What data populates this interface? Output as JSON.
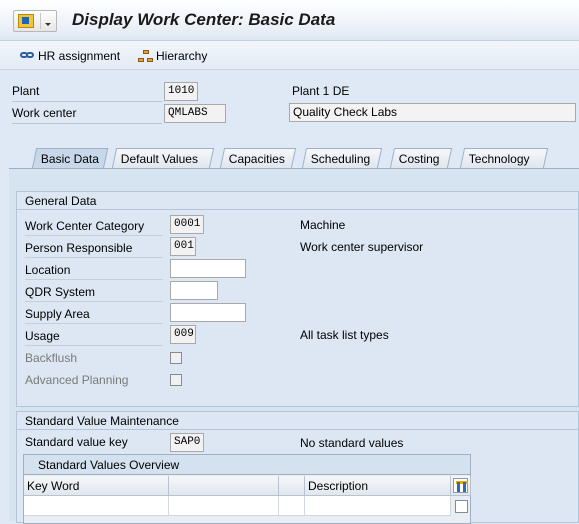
{
  "window": {
    "title": "Display Work Center: Basic Data"
  },
  "toolbar": {
    "hr_assignment": "HR assignment",
    "hierarchy": "Hierarchy"
  },
  "header": {
    "plant_label": "Plant",
    "plant_value": "1010",
    "plant_description": "Plant 1 DE",
    "work_center_label": "Work center",
    "work_center_value": "QMLABS",
    "work_center_description": "Quality Check Labs"
  },
  "tabs": [
    "Basic Data",
    "Default Values",
    "Capacities",
    "Scheduling",
    "Costing",
    "Technology"
  ],
  "general_data": {
    "title": "General Data",
    "work_center_category": {
      "label": "Work Center Category",
      "value": "0001",
      "description": "Machine"
    },
    "person_responsible": {
      "label": "Person Responsible",
      "value": "001",
      "description": "Work center supervisor"
    },
    "location": {
      "label": "Location",
      "value": ""
    },
    "qdr_system": {
      "label": "QDR System",
      "value": ""
    },
    "supply_area": {
      "label": "Supply Area",
      "value": ""
    },
    "usage": {
      "label": "Usage",
      "value": "009",
      "description": "All task list types"
    },
    "backflush": {
      "label": "Backflush",
      "checked": false
    },
    "advanced_planning": {
      "label": "Advanced Planning",
      "checked": false
    }
  },
  "standard_value_maintenance": {
    "title": "Standard Value Maintenance",
    "standard_value_key": {
      "label": "Standard value key",
      "value": "SAP0",
      "description": "No standard values"
    },
    "overview": {
      "title": "Standard Values Overview",
      "columns": [
        "Key Word",
        "",
        "",
        "Description"
      ]
    }
  }
}
